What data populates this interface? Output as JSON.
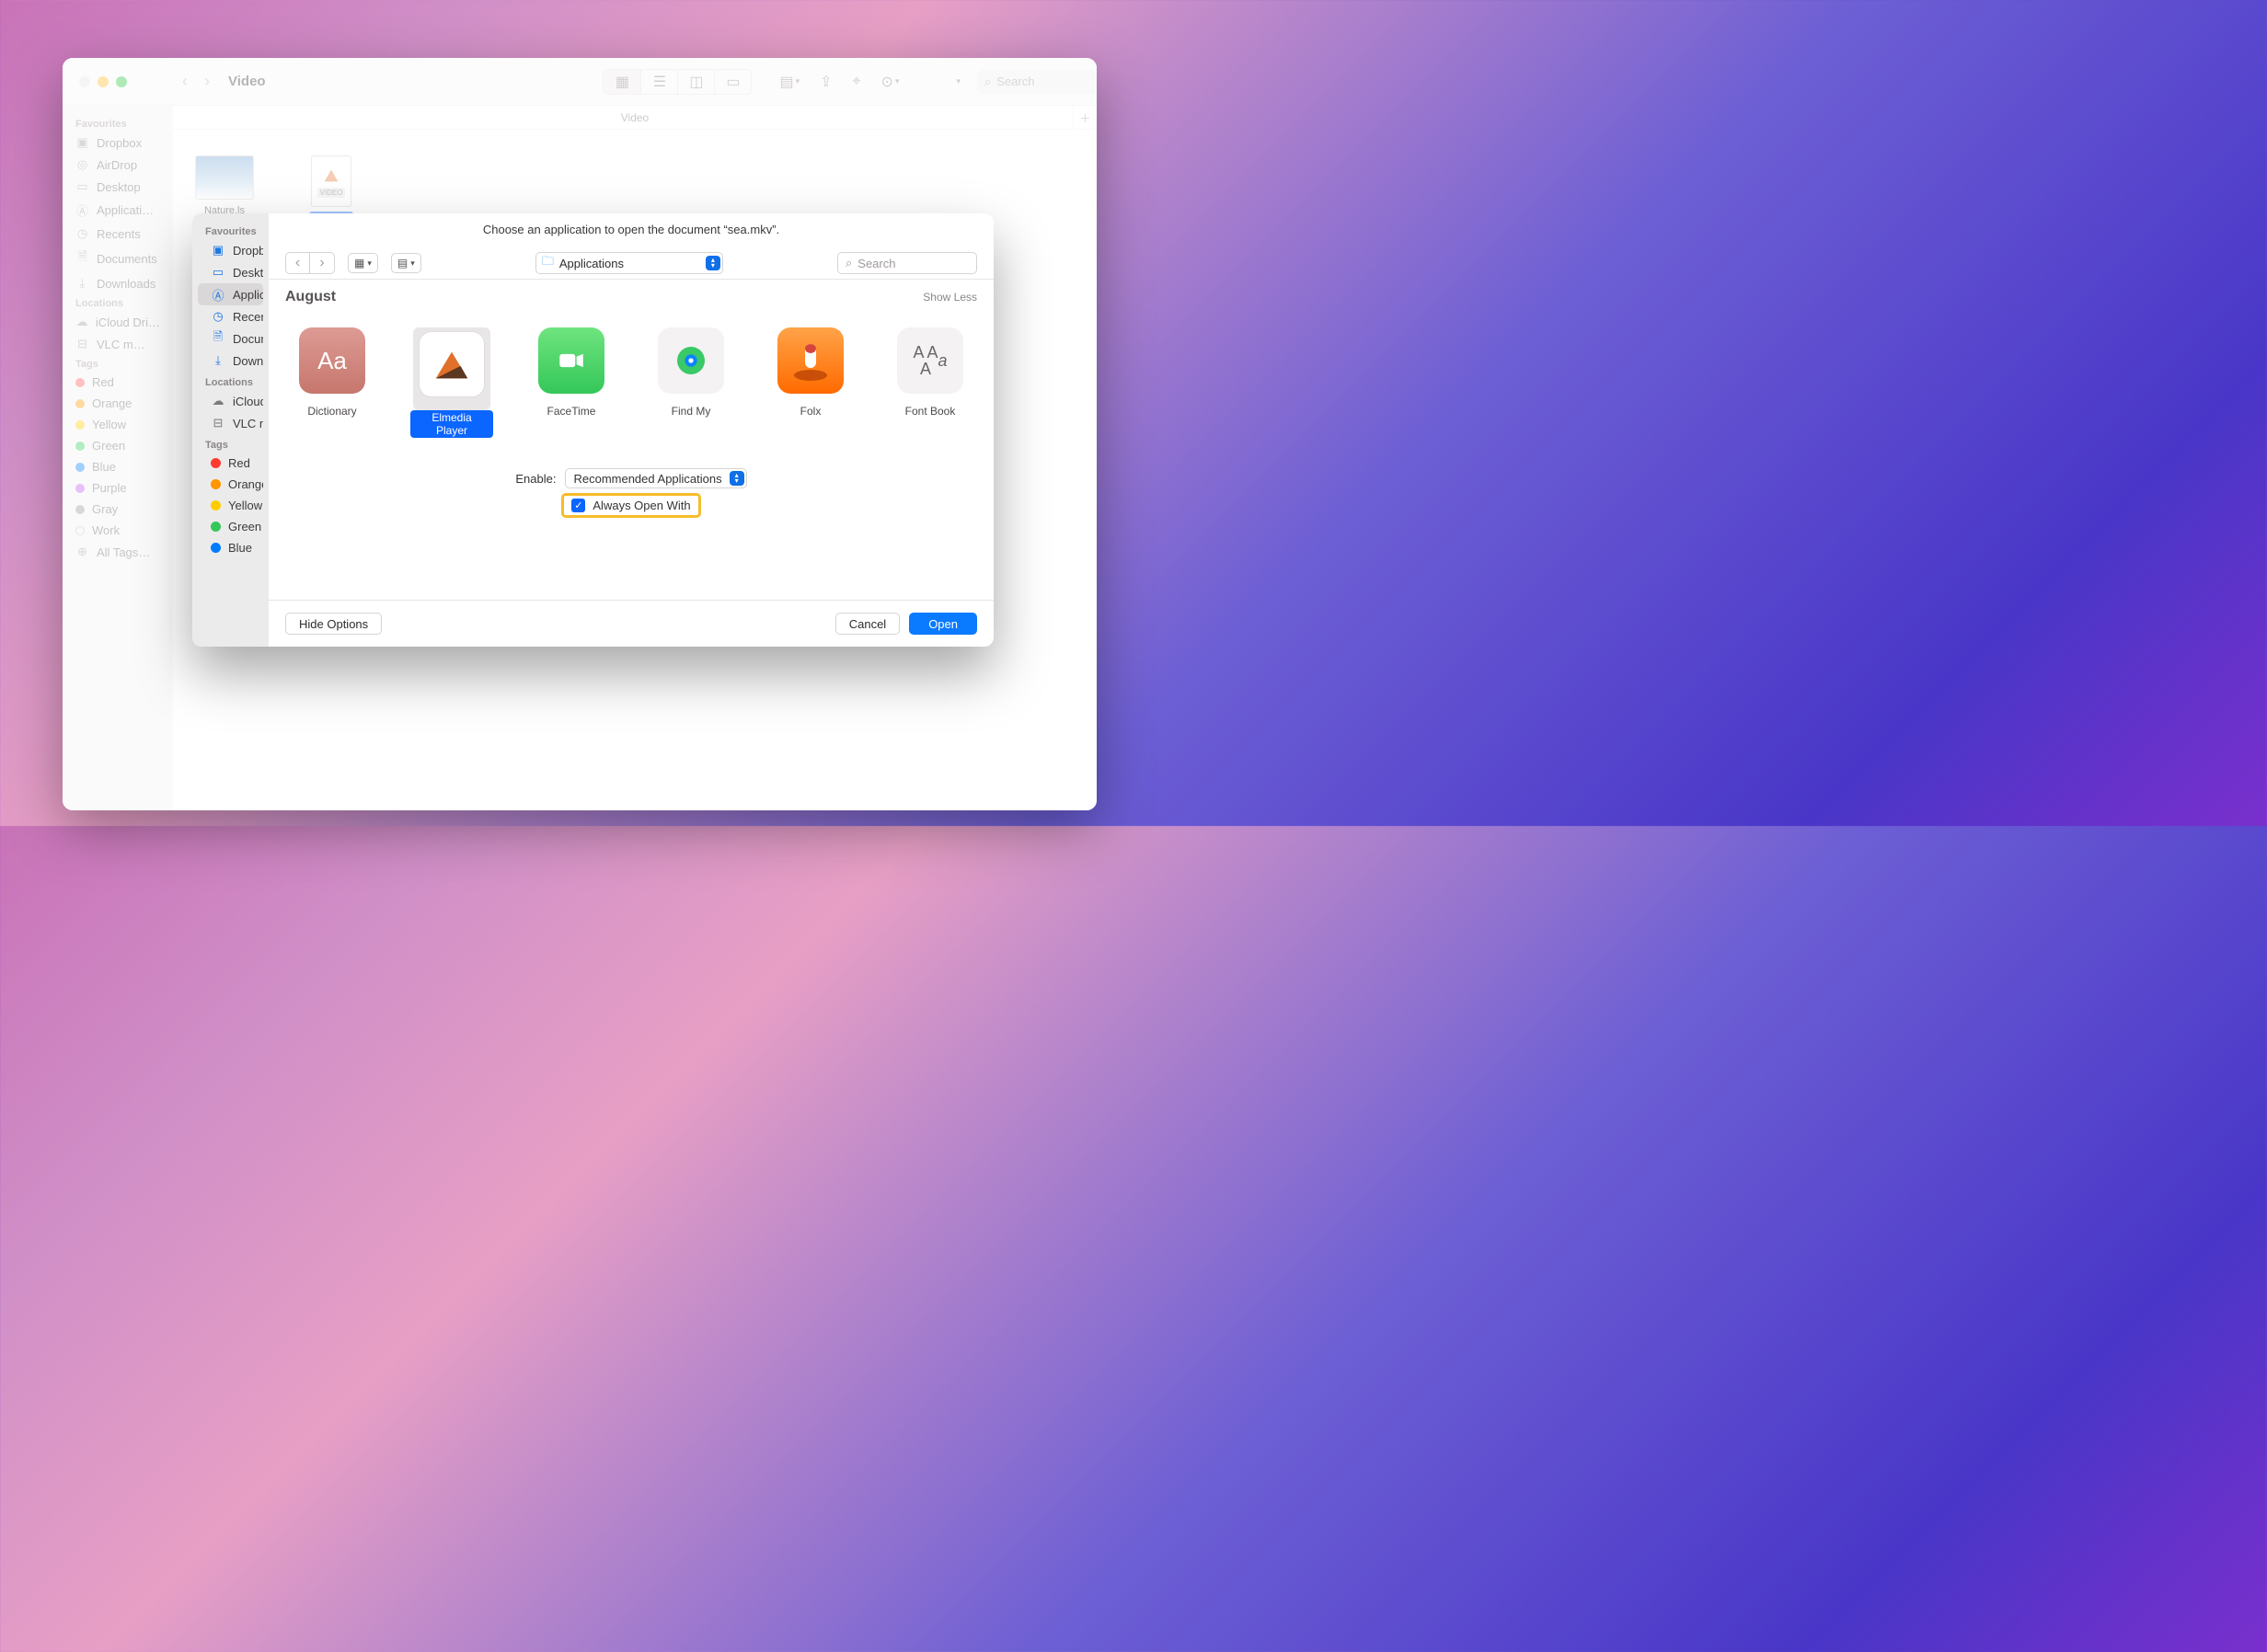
{
  "colors": {
    "accent": "#0a7aff",
    "highlight_border": "#f6bc2a"
  },
  "bg_finder": {
    "title": "Video",
    "pathbar": "Video",
    "search_placeholder": "Search",
    "sidebar": {
      "favourites_label": "Favourites",
      "favourites": [
        "Dropbox",
        "AirDrop",
        "Desktop",
        "Applicati…",
        "Recents",
        "Documents",
        "Downloads"
      ],
      "locations_label": "Locations",
      "locations": [
        "iCloud Dri…",
        "VLC m…"
      ],
      "tags_label": "Tags",
      "tags": [
        {
          "name": "Red",
          "color": "#ff5b57"
        },
        {
          "name": "Orange",
          "color": "#ff9f0a"
        },
        {
          "name": "Yellow",
          "color": "#ffcc00"
        },
        {
          "name": "Green",
          "color": "#30d158"
        },
        {
          "name": "Blue",
          "color": "#0a84ff"
        },
        {
          "name": "Purple",
          "color": "#bf5af2"
        },
        {
          "name": "Gray",
          "color": "#98989d"
        },
        {
          "name": "Work",
          "color": "#cfcfcf"
        },
        {
          "name": "All Tags…",
          "color": ""
        }
      ]
    },
    "files": [
      {
        "name": "Nature.ls",
        "kind": "image"
      },
      {
        "name": "sea.mkv",
        "badge": "VIDEO",
        "kind": "video-doc"
      }
    ]
  },
  "dialog": {
    "title": "Choose an application to open the document “sea.mkv”.",
    "location": "Applications",
    "search_placeholder": "Search",
    "month": "August",
    "show_less": "Show Less",
    "sidebar": {
      "favourites_label": "Favourites",
      "favourites": [
        "Dropbox",
        "Desktop",
        "Applicati...",
        "Recents",
        "Documents",
        "Downloads"
      ],
      "locations_label": "Locations",
      "locations": [
        "iCloud Dri...",
        "VLC m..."
      ],
      "tags_label": "Tags",
      "tags": [
        {
          "name": "Red",
          "color": "#ff3b30"
        },
        {
          "name": "Orange",
          "color": "#ff9500"
        },
        {
          "name": "Yellow",
          "color": "#ffcc00"
        },
        {
          "name": "Green",
          "color": "#34c759"
        },
        {
          "name": "Blue",
          "color": "#007aff"
        }
      ],
      "selected_index": 2
    },
    "apps": [
      "Dictionary",
      "Elmedia Player",
      "FaceTime",
      "Find My",
      "Folx",
      "Font Book"
    ],
    "selected_app_index": 1,
    "enable_label": "Enable:",
    "enable_value": "Recommended Applications",
    "always_label": "Always Open With",
    "always_checked": true,
    "buttons": {
      "hide_options": "Hide Options",
      "cancel": "Cancel",
      "open": "Open"
    }
  }
}
